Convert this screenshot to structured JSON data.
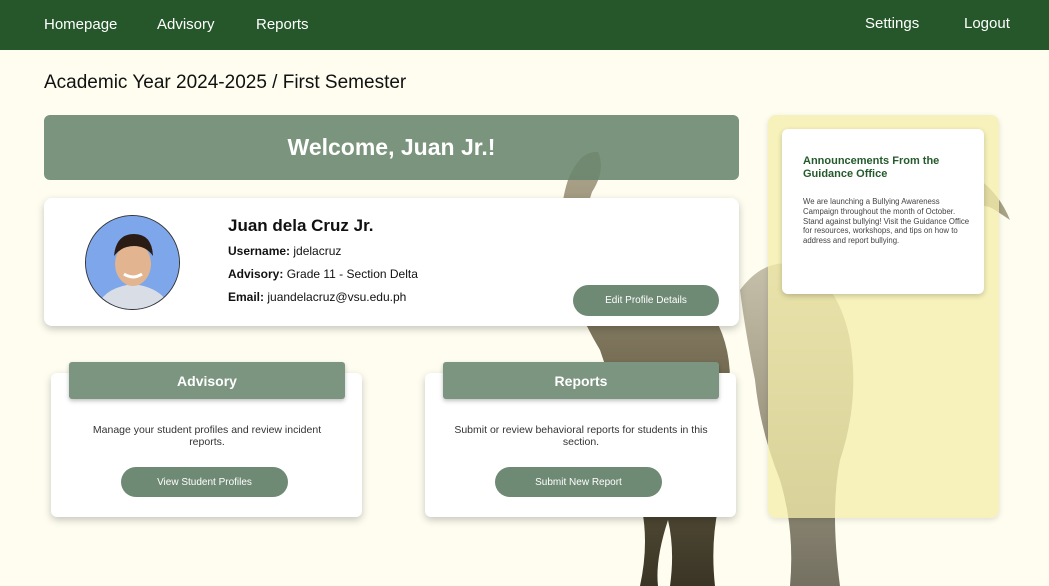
{
  "nav": {
    "homepage": "Homepage",
    "advisory": "Advisory",
    "reports": "Reports",
    "settings": "Settings",
    "logout": "Logout"
  },
  "page_title": "Academic Year 2024-2025 / First Semester",
  "welcome": "Welcome, Juan Jr.!",
  "profile": {
    "name": "Juan dela Cruz Jr.",
    "username_label": "Username:",
    "username": "jdelacruz",
    "advisory_label": "Advisory:",
    "advisory": "Grade 11 - Section Delta",
    "email_label": "Email:",
    "email": "juandelacruz@vsu.edu.ph",
    "edit_button": "Edit Profile Details"
  },
  "cards": {
    "advisory": {
      "title": "Advisory",
      "description": "Manage your student profiles and review incident reports.",
      "button": "View Student Profiles"
    },
    "reports": {
      "title": "Reports",
      "description": "Submit or review behavioral reports for students in this section.",
      "button": "Submit New Report"
    }
  },
  "announcements": {
    "title": "Announcements From the Guidance Office",
    "body": "We are launching a Bullying Awareness Campaign throughout the month of October. Stand against bullying! Visit the Guidance Office for resources, workshops, and tips on how to address and report bullying."
  },
  "colors": {
    "nav_bg": "#25572a",
    "page_bg": "#fefdf0",
    "accent_green": "#6f8a74",
    "announcement_title": "#245a2c",
    "announcement_panel": "#f4eeaa"
  }
}
